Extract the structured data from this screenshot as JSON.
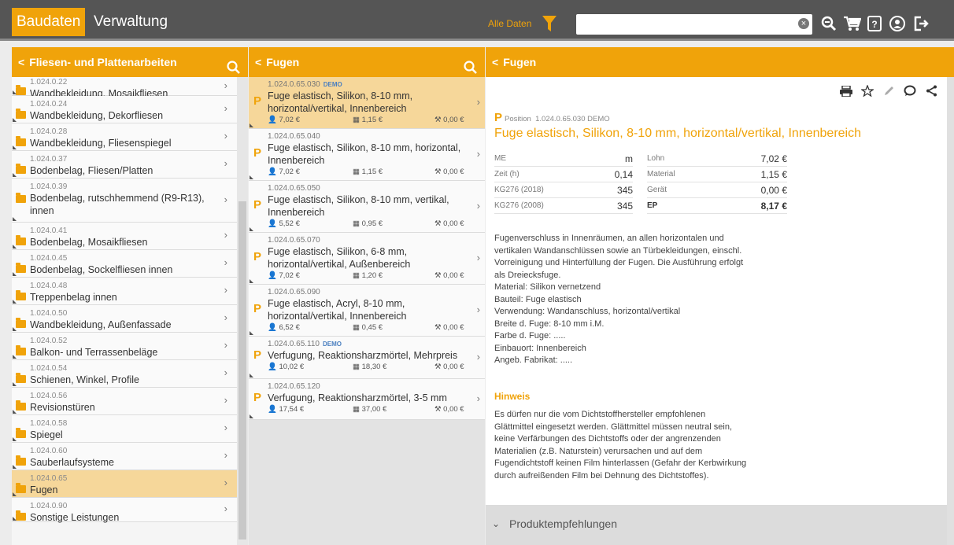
{
  "topbar": {
    "tab_active": "Baudaten",
    "tab_inactive": "Verwaltung",
    "filter_label": "Alle Daten",
    "search_value": "",
    "search_clear": "×",
    "icons": [
      "search-zoom-icon",
      "cart-icon",
      "help-icon",
      "user-icon",
      "logout-icon"
    ]
  },
  "left_panel": {
    "title": "Fliesen- und Plattenarbeiten",
    "back": "<",
    "items": [
      {
        "code": "1.024.0.22",
        "label": "Wandbekleidung, Mosaikfliesen"
      },
      {
        "code": "1.024.0.24",
        "label": "Wandbekleidung, Dekorfliesen"
      },
      {
        "code": "1.024.0.28",
        "label": "Wandbekleidung, Fliesenspiegel"
      },
      {
        "code": "1.024.0.37",
        "label": "Bodenbelag, Fliesen/Platten"
      },
      {
        "code": "1.024.0.39",
        "label": "Bodenbelag, rutschhemmend (R9-R13), innen"
      },
      {
        "code": "1.024.0.41",
        "label": "Bodenbelag, Mosaikfliesen"
      },
      {
        "code": "1.024.0.45",
        "label": "Bodenbelag, Sockelfliesen innen"
      },
      {
        "code": "1.024.0.48",
        "label": "Treppenbelag innen"
      },
      {
        "code": "1.024.0.50",
        "label": "Wandbekleidung, Außenfassade"
      },
      {
        "code": "1.024.0.52",
        "label": "Balkon- und Terrassenbeläge"
      },
      {
        "code": "1.024.0.54",
        "label": "Schienen, Winkel, Profile"
      },
      {
        "code": "1.024.0.56",
        "label": "Revisionstüren"
      },
      {
        "code": "1.024.0.58",
        "label": "Spiegel"
      },
      {
        "code": "1.024.0.60",
        "label": "Sauberlaufsysteme"
      },
      {
        "code": "1.024.0.65",
        "label": "Fugen"
      },
      {
        "code": "1.024.0.90",
        "label": "Sonstige Leistungen"
      }
    ]
  },
  "mid_panel": {
    "title": "Fugen",
    "back": "<",
    "items": [
      {
        "code": "1.024.0.65.030",
        "demo": "DEMO",
        "title": "Fuge elastisch, Silikon, 8-10 mm, horizontal/vertikal, Innenbereich",
        "lohn": "7,02 €",
        "material": "1,15 €",
        "geraet": "0,00 €"
      },
      {
        "code": "1.024.0.65.040",
        "demo": "",
        "title": "Fuge elastisch, Silikon, 8-10 mm, horizontal, Innenbereich",
        "lohn": "7,02 €",
        "material": "1,15 €",
        "geraet": "0,00 €"
      },
      {
        "code": "1.024.0.65.050",
        "demo": "",
        "title": "Fuge elastisch, Silikon, 8-10 mm, vertikal, Innenbereich",
        "lohn": "5,52 €",
        "material": "0,95 €",
        "geraet": "0,00 €"
      },
      {
        "code": "1.024.0.65.070",
        "demo": "",
        "title": "Fuge elastisch, Silikon, 6-8 mm, horizontal/vertikal, Außenbereich",
        "lohn": "7,02 €",
        "material": "1,20 €",
        "geraet": "0,00 €"
      },
      {
        "code": "1.024.0.65.090",
        "demo": "",
        "title": "Fuge elastisch, Acryl, 8-10 mm, horizontal/vertikal, Innenbereich",
        "lohn": "6,52 €",
        "material": "0,45 €",
        "geraet": "0,00 €"
      },
      {
        "code": "1.024.0.65.110",
        "demo": "DEMO",
        "title": "Verfugung, Reaktionsharzmörtel, Mehrpreis",
        "lohn": "10,02 €",
        "material": "18,30 €",
        "geraet": "0,00 €"
      },
      {
        "code": "1.024.0.65.120",
        "demo": "",
        "title": "Verfugung, Reaktionsharzmörtel, 3-5 mm",
        "lohn": "17,54 €",
        "material": "37,00 €",
        "geraet": "0,00 €"
      }
    ]
  },
  "detail": {
    "header": "Fugen",
    "back": "<",
    "p": "P",
    "position_label": "Position",
    "position_code": "1.024.0.65.030",
    "position_demo": "DEMO",
    "title": "Fuge elastisch, Silikon, 8-10 mm, horizontal/vertikal, Innenbereich",
    "table_left": [
      {
        "key": "ME",
        "value": "m"
      },
      {
        "key": "Zeit (h)",
        "value": "0,14"
      },
      {
        "key": "KG276 (2018)",
        "value": "345"
      },
      {
        "key": "KG276 (2008)",
        "value": "345"
      }
    ],
    "table_right": [
      {
        "key": "Lohn",
        "value": "7,02 €"
      },
      {
        "key": "Material",
        "value": "1,15 €"
      },
      {
        "key": "Gerät",
        "value": "0,00 €"
      },
      {
        "key": "EP",
        "value": "8,17 €"
      }
    ],
    "description": [
      "Fugenverschluss in Innenräumen, an allen horizontalen und",
      "vertikalen Wandanschlüssen sowie an Türbekleidungen, einschl.",
      "Vorreinigung und Hinterfüllung der Fugen. Die Ausführung erfolgt",
      "als Dreiecksfuge.",
      "Material: Silikon vernetzend",
      "Bauteil: Fuge elastisch",
      "Verwendung: Wandanschluss, horizontal/vertikal",
      "Breite d. Fuge: 8-10 mm i.M.",
      "Farbe d. Fuge: .....",
      "Einbauort: Innenbereich",
      "Angeb. Fabrikat: ....."
    ],
    "hint_title": "Hinweis",
    "hint": [
      "Es dürfen nur die vom Dichtstoffhersteller empfohlenen",
      "Glättmittel eingesetzt werden. Glättmittel müssen neutral sein,",
      "keine Verfärbungen des Dichtstoffs oder der angrenzenden",
      "Materialien (z.B. Naturstein) verursachen und auf dem",
      "Fugendichtstoff keinen Film hinterlassen (Gefahr der Kerbwirkung",
      "durch aufreißenden Film bei Dehnung des Dichtstoffes)."
    ],
    "produkt_label": "Produktempfehlungen"
  },
  "colors": {
    "accent": "#f0a30a",
    "topbar": "#555555",
    "selected": "#f6d79a"
  }
}
